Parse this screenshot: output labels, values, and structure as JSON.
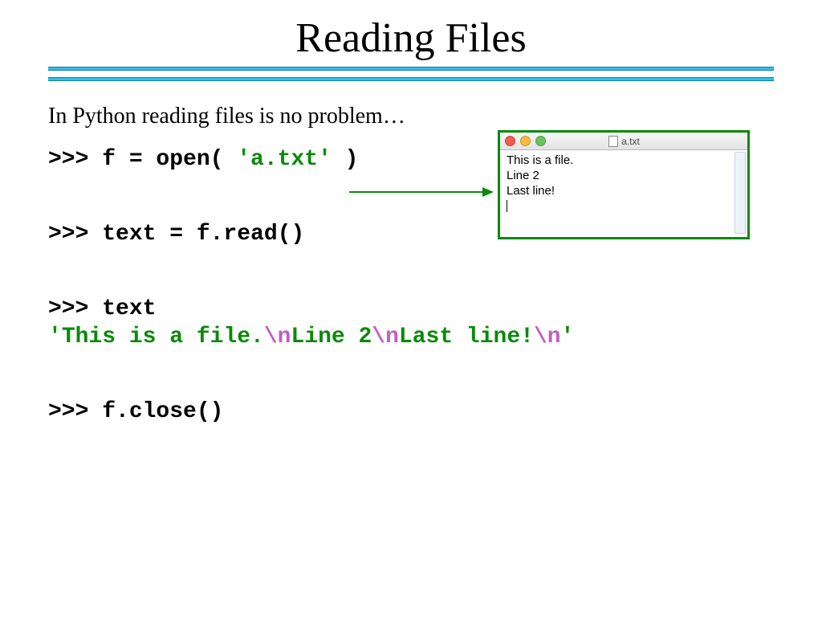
{
  "title": "Reading Files",
  "intro": "In Python reading files is no problem…",
  "code": {
    "line1_prefix": ">>> f = open( ",
    "line1_str": "'a.txt'",
    "line1_suffix": " )",
    "line2": ">>> text = f.read()",
    "line3": ">>> text",
    "line4_q1": "'",
    "line4_s1": "This is a file.",
    "line4_e1": "\\n",
    "line4_s2": "Line 2",
    "line4_e2": "\\n",
    "line4_s3": "Last line!",
    "line4_e3": "\\n",
    "line4_q2": "'",
    "line5": ">>> f.close()"
  },
  "filewin": {
    "title": "a.txt",
    "lines": {
      "l1": "This is a file.",
      "l2": "Line 2",
      "l3": "Last line!"
    }
  }
}
